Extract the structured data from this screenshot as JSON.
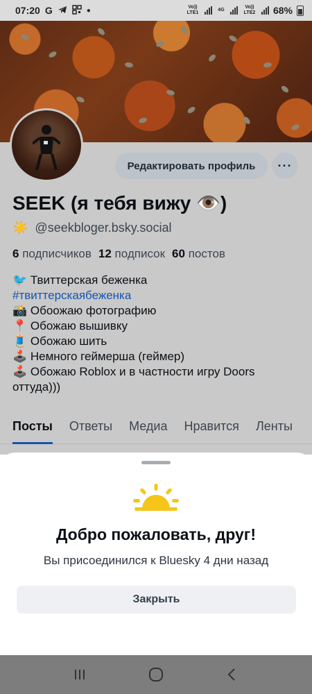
{
  "status_bar": {
    "time": "07:20",
    "notif_g": "G",
    "network_1": "Vo)) LTE1",
    "network_2": "4G",
    "network_3": "Vo)) LTE2",
    "battery": "68%"
  },
  "profile": {
    "edit_button": "Редактировать профиль",
    "more_button": "···",
    "display_name": "SEEK (я тебя вижу 👁️)",
    "handle_emoji": "☀️",
    "handle": "@seekbloger.bsky.social",
    "stats": {
      "followers_count": "6",
      "followers_label": "подписчиков",
      "following_count": "12",
      "following_label": "подписок",
      "posts_count": "60",
      "posts_label": "постов"
    },
    "bio": {
      "line1": "🐦  Твиттерская беженка",
      "line2": "#твиттерскаябеженка",
      "line3": "📸 Обоожаю фотографию",
      "line4": "📍 Обожаю вышивку",
      "line5": "🧵 Обожаю шить",
      "line6": "🕹️ Немного геймерша (геймер)",
      "line7": "🕹️ Обожаю Roblox и в частности игру Doors",
      "line8": "оттуда)))"
    },
    "tabs": [
      "Посты",
      "Ответы",
      "Медиа",
      "Нравится",
      "Ленты"
    ]
  },
  "welcome_sheet": {
    "title": "Добро пожаловать, друг!",
    "subtitle": "Вы присоединился к Bluesky 4 дни назад",
    "close_button": "Закрыть"
  },
  "colors": {
    "accent": "#1455b0",
    "sun": "#f5c518",
    "dim_overlay": "#c9c9c9",
    "navbar": "#7d7d7d"
  }
}
